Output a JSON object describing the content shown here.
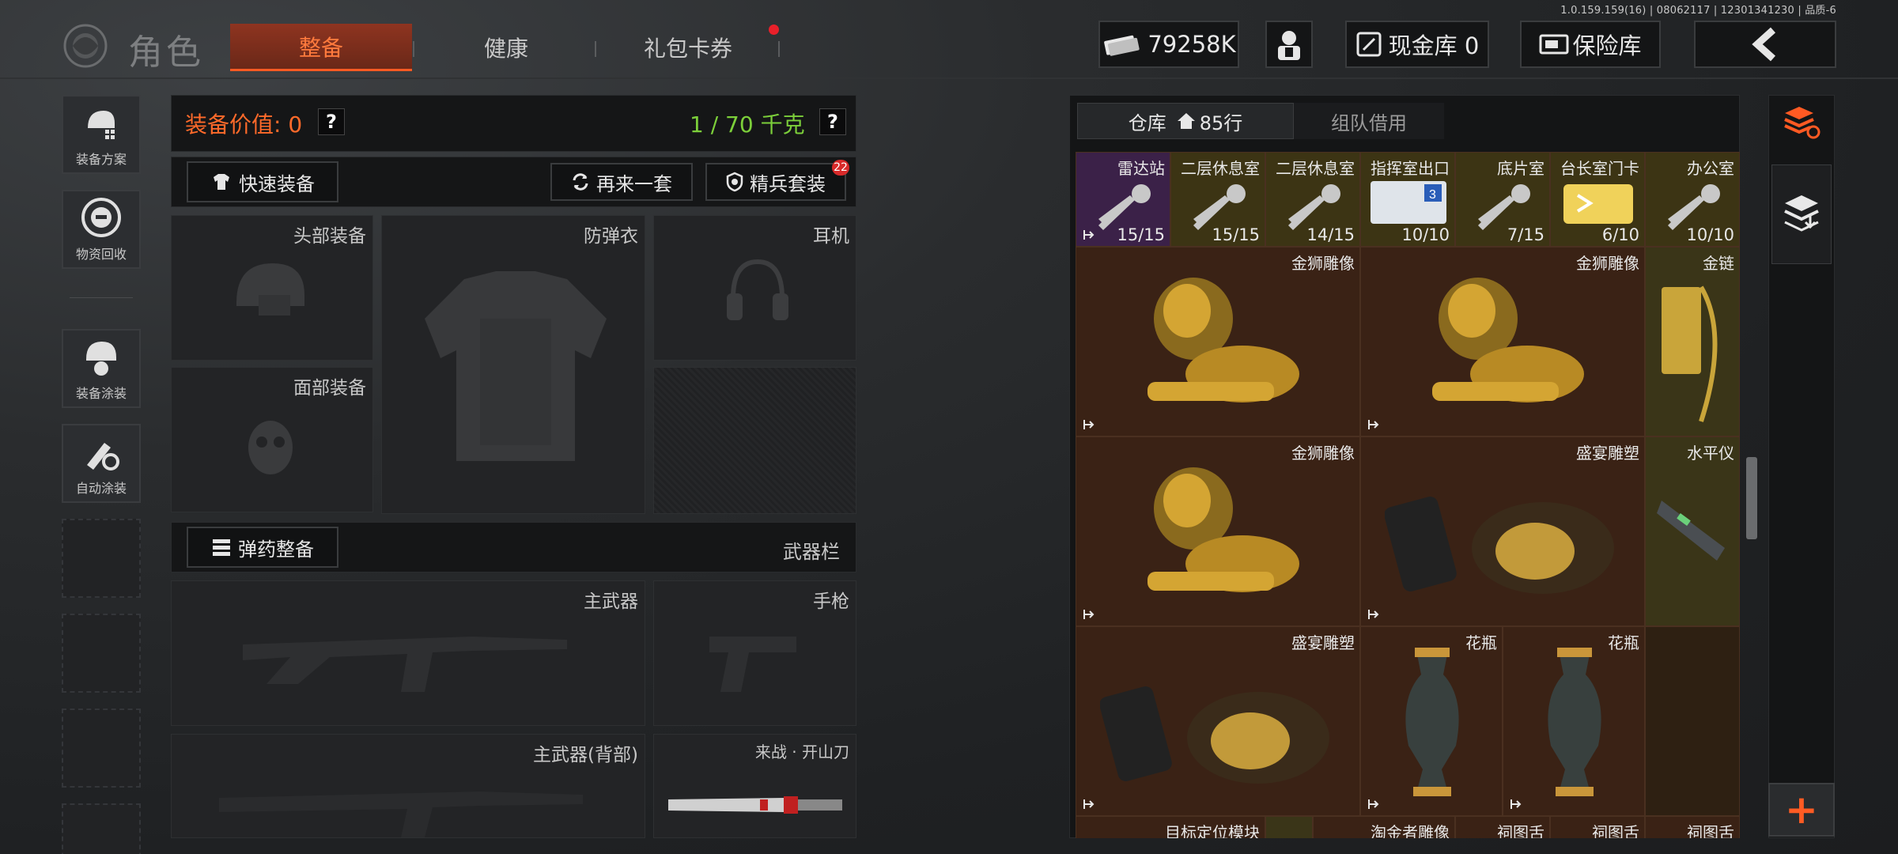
{
  "version_text": "1.0.159.159(16) | 08062117 | 12301341230 | 品质-6",
  "header": {
    "title": "角色",
    "tabs": [
      {
        "label": "整备",
        "active": true
      },
      {
        "label": "健康"
      },
      {
        "label": "礼包卡券",
        "badge": true
      }
    ]
  },
  "topbar": {
    "money": "79258K",
    "cash_label": "现金库 0",
    "safe_label": "保险库"
  },
  "left_menu": [
    {
      "label": "装备方案",
      "icon": "helmet-plan-icon"
    },
    {
      "label": "物资回收",
      "icon": "recycle-face-icon"
    },
    {
      "label": "装备涂装",
      "icon": "paint-helmet-icon"
    },
    {
      "label": "自动涂装",
      "icon": "auto-paint-icon"
    }
  ],
  "equipment": {
    "value_label": "装备价值: 0",
    "weight_label": "1 / 70 千克",
    "quick_equip": "快速装备",
    "again_label": "再来一套",
    "elite_label": "精兵套装",
    "elite_badge": "22",
    "slots": {
      "head": "头部装备",
      "armor": "防弹衣",
      "headset": "耳机",
      "face": "面部装备"
    },
    "ammo_label": "弹药整备",
    "weapon_bar": "武器栏",
    "weapons": {
      "primary": "主武器",
      "pistol": "手枪",
      "primary_back": "主武器(背部)",
      "melee": "来战 · 开山刀"
    }
  },
  "warehouse": {
    "tab_warehouse": "仓库",
    "tab_rows": "85行",
    "tab_team": "组队借用",
    "row1": [
      {
        "name": "雷达站",
        "count": "15/15"
      },
      {
        "name": "二层休息室",
        "count": "15/15"
      },
      {
        "name": "二层休息室",
        "count": "14/15"
      },
      {
        "name": "指挥室出口",
        "count": "10/10"
      },
      {
        "name": "底片室",
        "count": "7/15"
      },
      {
        "name": "台长室门卡",
        "count": "6/10"
      },
      {
        "name": "办公室",
        "count": "10/10"
      }
    ],
    "items": {
      "lion1": "金狮雕像",
      "lion2": "金狮雕像",
      "chain": "金链",
      "lion3": "金狮雕像",
      "bust1": "盛宴雕塑",
      "level": "水平仪",
      "bust2": "盛宴雕塑",
      "vase1": "花瓶",
      "vase2": "花瓶"
    },
    "bottom_row": [
      "目标定位模块",
      "淘金者雕像",
      "祠图舌",
      "祠图舌",
      "祠图舌"
    ]
  },
  "colors": {
    "accent": "#ff5a23",
    "weight_green": "#7ccf3a",
    "value_orange": "#ff6a2a"
  }
}
